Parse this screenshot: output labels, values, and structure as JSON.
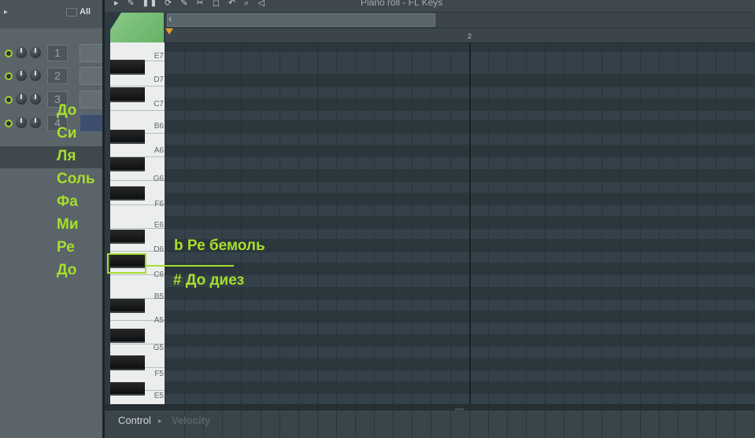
{
  "toolbar": {
    "title": "Piano roll - FL Keys",
    "icons": [
      "pencil-icon",
      "paint-icon",
      "delete-icon",
      "mute-icon",
      "slice-icon",
      "select-icon",
      "zoom-icon",
      "playback-icon"
    ]
  },
  "channel_rack": {
    "filter_label": "All",
    "channels": [
      {
        "number": "1",
        "active": false
      },
      {
        "number": "2",
        "active": false
      },
      {
        "number": "3",
        "active": false
      },
      {
        "number": "4",
        "active": true
      }
    ]
  },
  "ruler": {
    "bar_label": "2"
  },
  "keyboard": {
    "octave_labels": [
      "E7",
      "D7",
      "C7",
      "B6",
      "A6",
      "G6",
      "F6",
      "E6",
      "D6",
      "C6",
      "B5",
      "A5",
      "G5",
      "F5",
      "E5"
    ]
  },
  "control": {
    "label": "Control",
    "parameter": "Velocity"
  },
  "annotations": {
    "solfege": [
      "До",
      "Си",
      "Ля",
      "Соль",
      "Фа",
      "Ми",
      "Ре",
      "До"
    ],
    "flat_text": "b Ре бемоль",
    "sharp_text": "# До диез"
  },
  "colors": {
    "annotation_green": "#a6de2e",
    "grid_background": "#344148",
    "piano_header_green": "#78bd76",
    "ruler_marker": "#e79b2f"
  }
}
